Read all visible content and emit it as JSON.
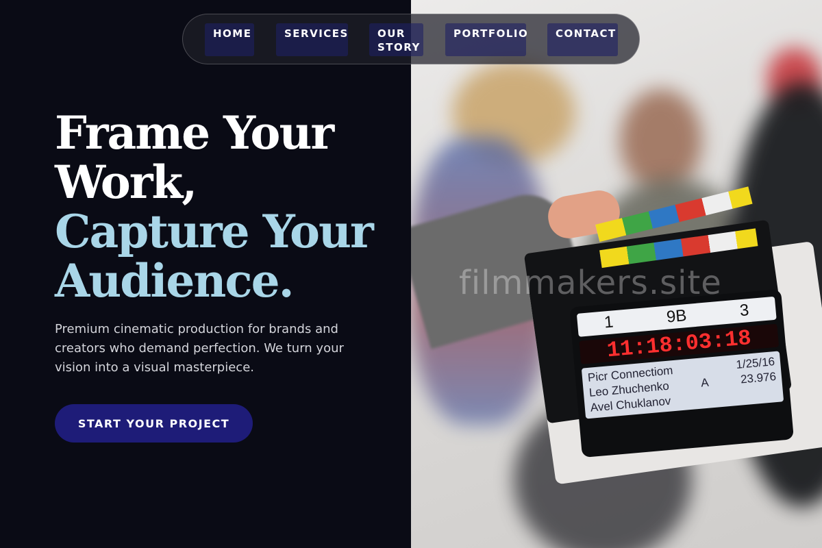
{
  "nav": {
    "items": [
      {
        "label": "HOME"
      },
      {
        "label": "SERVICES"
      },
      {
        "label": "OUR STORY"
      },
      {
        "label": "PORTFOLIO"
      },
      {
        "label": "CONTACT"
      }
    ]
  },
  "hero": {
    "title_line1": "Frame Your",
    "title_line2": "Work,",
    "title_line3": "Capture Your",
    "title_line4": "Audience.",
    "subtitle": "Premium cinematic production for brands and creators who demand perfection. We turn your vision into a visual masterpiece.",
    "cta_label": "START YOUR PROJECT"
  },
  "image": {
    "watermark": "filmmakers.site",
    "slate": {
      "scene": "1",
      "take": "9B",
      "roll": "3",
      "timecode": "11:18:03:18",
      "production": "Picr Connectiom",
      "director": "Leo Zhuchenko",
      "camera": "Avel Chuklanov",
      "date": "1/25/16",
      "cam_letter": "A",
      "fps": "23.976"
    }
  },
  "colors": {
    "accent_blue": "#a9d6e8",
    "cta_bg": "#1e1c78",
    "panel_bg": "#0a0b15"
  }
}
